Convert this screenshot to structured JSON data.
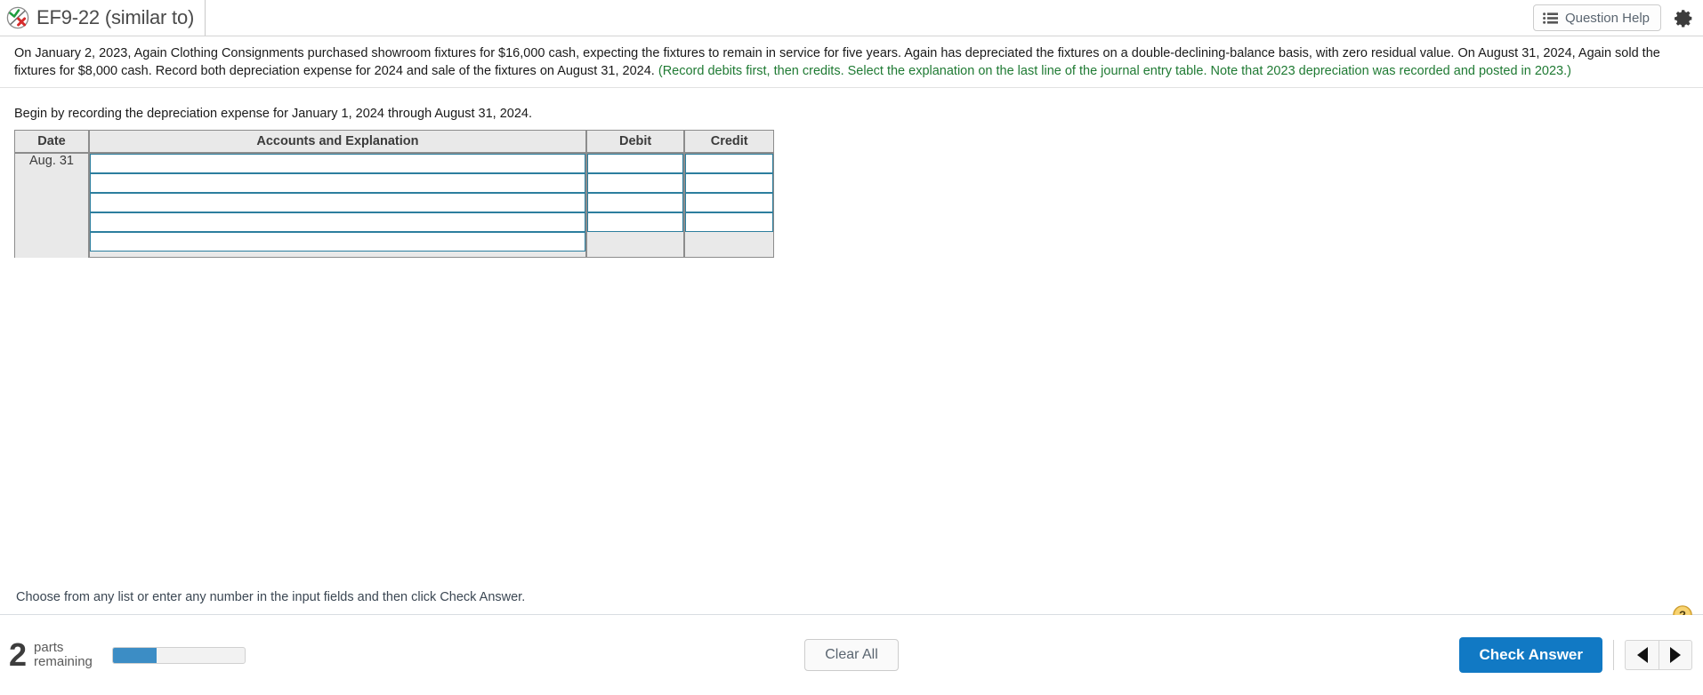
{
  "header": {
    "icon_name": "check-x-circle-icon",
    "title": "EF9-22 (similar to)",
    "question_help_label": "Question Help",
    "list_icon_name": "list-icon",
    "gear_icon_name": "gear-icon"
  },
  "problem": {
    "black_part_1": "On January 2, 2023, Again Clothing Consignments purchased showroom fixtures for $16,000 cash, expecting the fixtures to remain in service for five years. Again has depreciated the fixtures on a double-declining-balance basis, with zero residual value. On August 31, 2024, Again sold the fixtures for $8,000 cash. Record both depreciation expense for 2024 and sale of the fixtures on August 31, 2024. ",
    "green_part": "(Record debits first, then credits. Select the explanation on the last line of the journal entry table. Note that 2023 depreciation was recorded and posted in 2023.)"
  },
  "instruction": "Begin by recording the depreciation expense for January 1, 2024 through August 31, 2024.",
  "journal": {
    "columns": [
      "Date",
      "Accounts and Explanation",
      "Debit",
      "Credit"
    ],
    "date_value": "Aug. 31",
    "rows": [
      {
        "accounts": "",
        "debit": "",
        "credit": "",
        "has_amounts": true
      },
      {
        "accounts": "",
        "debit": "",
        "credit": "",
        "has_amounts": true
      },
      {
        "accounts": "",
        "debit": "",
        "credit": "",
        "has_amounts": true
      },
      {
        "accounts": "",
        "debit": "",
        "credit": "",
        "has_amounts": true
      },
      {
        "accounts": "",
        "debit": "",
        "credit": "",
        "has_amounts": false
      }
    ]
  },
  "footnote": {
    "text": "Choose from any list or enter any number in the input fields and then click Check Answer.",
    "help_icon_name": "question-mark-help-icon",
    "help_glyph": "?"
  },
  "bottom": {
    "parts_count": "2",
    "parts_label_line1": "parts",
    "parts_label_line2": "remaining",
    "progress_percent": 33,
    "clear_all_label": "Clear All",
    "check_answer_label": "Check Answer",
    "prev_icon_name": "previous-arrow-icon",
    "next_icon_name": "next-arrow-icon"
  },
  "colors": {
    "accent_blue": "#1179c4",
    "progress_blue": "#3c8dc5",
    "green_text": "#1f7a33",
    "input_border": "#2c7e9e",
    "table_bg": "#e9e9e9",
    "help_gold": "#f0c04a"
  }
}
